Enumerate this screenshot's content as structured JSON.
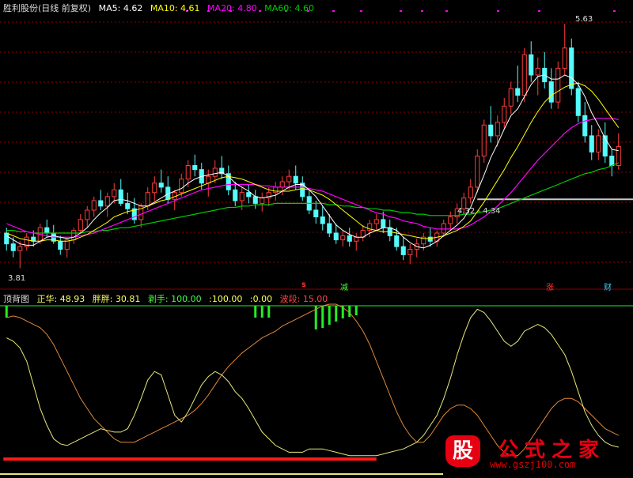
{
  "colors": {
    "bg": "#000000",
    "up": "#ff3c3c",
    "down": "#54fcfc",
    "ma5": "#ffffff",
    "ma10": "#ffff00",
    "ma20": "#ff00ff",
    "ma60": "#00cc00",
    "grid": "#8b0000",
    "line_a": "#e8e87a",
    "line_b": "#e0883a",
    "red_band": "#ff1a1a",
    "green_bar": "#22ee22",
    "support": "#c8c8c8"
  },
  "header": {
    "title": "胜利股份(日线 前复权)",
    "ma5_label": "MA5:",
    "ma5_value": "4.62",
    "ma10_label": "MA10:",
    "ma10_value": "4.61",
    "ma20_label": "MA20:",
    "ma20_value": "4.80",
    "ma60_label": "MA60:",
    "ma60_value": "4.60"
  },
  "indicator_header": {
    "name": "顶背图",
    "zhenghua_label": "正华:",
    "zhenghua_value": "48.93",
    "pangpang_label": "胖胖:",
    "pangpang_value": "30.81",
    "baoshou_label": "剥手:",
    "baoshou_value": "100.00",
    "v1_label": ":",
    "v1_value": "100.00",
    "v2_label": ":",
    "v2_value": "0.00",
    "boduan_label": "波段:",
    "boduan_value": "15.00"
  },
  "annotations": {
    "high_label": "5.63",
    "low_label": "3.81",
    "range_label": "4.32 - 4.34",
    "signal_s": "s",
    "signal_jian": "减",
    "signal_zhang": "涨",
    "signal_cai": "财"
  },
  "logo": {
    "mark": "股",
    "title": "公式之家",
    "url": "www.gszj100.com"
  },
  "chart_data": {
    "type": "candlestick",
    "price_range": [
      3.7,
      5.7
    ],
    "indicator_range": [
      0,
      100
    ],
    "high": 5.63,
    "low": 3.81,
    "candles": [
      [
        4.08,
        4.12,
        3.95,
        4.0
      ],
      [
        4.0,
        4.05,
        3.9,
        3.95
      ],
      [
        3.95,
        4.02,
        3.82,
        3.98
      ],
      [
        3.98,
        4.08,
        3.95,
        4.05
      ],
      [
        4.05,
        4.1,
        3.98,
        4.02
      ],
      [
        4.02,
        4.15,
        4.0,
        4.12
      ],
      [
        4.12,
        4.18,
        4.05,
        4.08
      ],
      [
        4.08,
        4.14,
        4.0,
        4.02
      ],
      [
        4.02,
        4.06,
        3.92,
        3.96
      ],
      [
        3.96,
        4.05,
        3.9,
        4.03
      ],
      [
        4.03,
        4.12,
        4.0,
        4.1
      ],
      [
        4.1,
        4.22,
        4.08,
        4.18
      ],
      [
        4.18,
        4.28,
        4.12,
        4.25
      ],
      [
        4.25,
        4.35,
        4.2,
        4.32
      ],
      [
        4.32,
        4.4,
        4.25,
        4.28
      ],
      [
        4.28,
        4.38,
        4.2,
        4.35
      ],
      [
        4.35,
        4.45,
        4.3,
        4.4
      ],
      [
        4.4,
        4.48,
        4.28,
        4.3
      ],
      [
        4.3,
        4.38,
        4.22,
        4.26
      ],
      [
        4.26,
        4.34,
        4.15,
        4.18
      ],
      [
        4.18,
        4.3,
        4.12,
        4.28
      ],
      [
        4.28,
        4.42,
        4.25,
        4.38
      ],
      [
        4.38,
        4.5,
        4.32,
        4.45
      ],
      [
        4.45,
        4.55,
        4.38,
        4.42
      ],
      [
        4.42,
        4.5,
        4.3,
        4.33
      ],
      [
        4.33,
        4.4,
        4.25,
        4.38
      ],
      [
        4.38,
        4.52,
        4.35,
        4.48
      ],
      [
        4.48,
        4.62,
        4.42,
        4.58
      ],
      [
        4.58,
        4.66,
        4.5,
        4.55
      ],
      [
        4.55,
        4.6,
        4.4,
        4.45
      ],
      [
        4.45,
        4.55,
        4.35,
        4.5
      ],
      [
        4.5,
        4.62,
        4.45,
        4.56
      ],
      [
        4.56,
        4.65,
        4.48,
        4.52
      ],
      [
        4.52,
        4.58,
        4.36,
        4.4
      ],
      [
        4.4,
        4.46,
        4.28,
        4.32
      ],
      [
        4.32,
        4.42,
        4.25,
        4.38
      ],
      [
        4.38,
        4.44,
        4.3,
        4.35
      ],
      [
        4.35,
        4.4,
        4.26,
        4.3
      ],
      [
        4.3,
        4.38,
        4.24,
        4.34
      ],
      [
        4.34,
        4.42,
        4.28,
        4.38
      ],
      [
        4.38,
        4.46,
        4.32,
        4.42
      ],
      [
        4.42,
        4.5,
        4.36,
        4.46
      ],
      [
        4.46,
        4.55,
        4.4,
        4.5
      ],
      [
        4.5,
        4.58,
        4.4,
        4.45
      ],
      [
        4.45,
        4.5,
        4.32,
        4.35
      ],
      [
        4.35,
        4.4,
        4.22,
        4.25
      ],
      [
        4.25,
        4.32,
        4.15,
        4.2
      ],
      [
        4.2,
        4.28,
        4.1,
        4.15
      ],
      [
        4.15,
        4.22,
        4.05,
        4.08
      ],
      [
        4.08,
        4.15,
        4.0,
        4.03
      ],
      [
        4.03,
        4.1,
        3.98,
        4.06
      ],
      [
        4.06,
        4.12,
        3.98,
        4.02
      ],
      [
        4.02,
        4.08,
        3.95,
        4.05
      ],
      [
        4.05,
        4.14,
        4.02,
        4.1
      ],
      [
        4.1,
        4.18,
        4.05,
        4.15
      ],
      [
        4.15,
        4.22,
        4.1,
        4.18
      ],
      [
        4.18,
        4.24,
        4.08,
        4.12
      ],
      [
        4.12,
        4.18,
        4.02,
        4.06
      ],
      [
        4.06,
        4.12,
        3.95,
        3.98
      ],
      [
        3.98,
        4.05,
        3.88,
        3.92
      ],
      [
        3.92,
        4.0,
        3.85,
        3.96
      ],
      [
        3.96,
        4.04,
        3.9,
        4.0
      ],
      [
        4.0,
        4.08,
        3.95,
        4.05
      ],
      [
        4.05,
        4.12,
        3.98,
        4.02
      ],
      [
        4.02,
        4.1,
        3.98,
        4.08
      ],
      [
        4.08,
        4.18,
        4.05,
        4.15
      ],
      [
        4.15,
        4.24,
        4.1,
        4.2
      ],
      [
        4.2,
        4.3,
        4.15,
        4.26
      ],
      [
        4.26,
        4.38,
        4.22,
        4.34
      ],
      [
        4.34,
        4.48,
        4.3,
        4.42
      ],
      [
        4.42,
        4.7,
        4.38,
        4.65
      ],
      [
        4.65,
        4.92,
        4.6,
        4.88
      ],
      [
        4.88,
        5.02,
        4.75,
        4.8
      ],
      [
        4.8,
        4.95,
        4.72,
        4.9
      ],
      [
        4.9,
        5.08,
        4.85,
        5.02
      ],
      [
        5.02,
        5.2,
        4.96,
        5.15
      ],
      [
        5.15,
        5.32,
        5.05,
        5.1
      ],
      [
        5.1,
        5.45,
        5.05,
        5.4
      ],
      [
        5.4,
        5.5,
        5.2,
        5.25
      ],
      [
        5.25,
        5.38,
        5.1,
        5.3
      ],
      [
        5.3,
        5.42,
        5.15,
        5.2
      ],
      [
        5.2,
        5.3,
        5.0,
        5.05
      ],
      [
        5.05,
        5.35,
        5.0,
        5.3
      ],
      [
        5.3,
        5.63,
        5.25,
        5.45
      ],
      [
        5.45,
        5.52,
        5.1,
        5.15
      ],
      [
        5.15,
        5.2,
        4.9,
        4.95
      ],
      [
        4.95,
        5.05,
        4.75,
        4.8
      ],
      [
        4.8,
        4.88,
        4.62,
        4.68
      ],
      [
        4.68,
        4.85,
        4.62,
        4.8
      ],
      [
        4.8,
        4.9,
        4.6,
        4.65
      ],
      [
        4.65,
        4.7,
        4.5,
        4.58
      ],
      [
        4.58,
        4.82,
        4.55,
        4.72
      ]
    ],
    "ma5": [
      4.06,
      4.03,
      4.0,
      3.99,
      3.99,
      4.02,
      4.05,
      4.06,
      4.05,
      4.04,
      4.05,
      4.08,
      4.12,
      4.18,
      4.23,
      4.27,
      4.32,
      4.33,
      4.32,
      4.3,
      4.28,
      4.28,
      4.31,
      4.34,
      4.37,
      4.39,
      4.41,
      4.45,
      4.48,
      4.5,
      4.51,
      4.52,
      4.53,
      4.5,
      4.45,
      4.42,
      4.39,
      4.35,
      4.34,
      4.35,
      4.36,
      4.39,
      4.42,
      4.44,
      4.44,
      4.4,
      4.35,
      4.28,
      4.21,
      4.14,
      4.1,
      4.07,
      4.05,
      4.05,
      4.08,
      4.1,
      4.12,
      4.12,
      4.1,
      4.05,
      4.01,
      3.98,
      3.97,
      3.99,
      4.02,
      4.06,
      4.1,
      4.14,
      4.19,
      4.27,
      4.39,
      4.51,
      4.64,
      4.74,
      4.85,
      4.95,
      5.0,
      5.09,
      5.18,
      5.24,
      5.25,
      5.22,
      5.22,
      5.25,
      5.23,
      5.18,
      5.09,
      4.97,
      4.88,
      4.78,
      4.7,
      4.69
    ],
    "ma10": [
      4.08,
      4.06,
      4.04,
      4.03,
      4.02,
      4.02,
      4.03,
      4.03,
      4.02,
      4.02,
      4.03,
      4.05,
      4.07,
      4.1,
      4.13,
      4.16,
      4.2,
      4.22,
      4.24,
      4.25,
      4.26,
      4.28,
      4.3,
      4.32,
      4.33,
      4.35,
      4.37,
      4.39,
      4.41,
      4.43,
      4.45,
      4.47,
      4.49,
      4.5,
      4.49,
      4.48,
      4.46,
      4.44,
      4.42,
      4.4,
      4.39,
      4.39,
      4.39,
      4.4,
      4.41,
      4.4,
      4.38,
      4.36,
      4.33,
      4.29,
      4.25,
      4.21,
      4.17,
      4.13,
      4.11,
      4.1,
      4.09,
      4.09,
      4.08,
      4.07,
      4.06,
      4.05,
      4.04,
      4.04,
      4.05,
      4.06,
      4.08,
      4.1,
      4.13,
      4.17,
      4.24,
      4.31,
      4.39,
      4.47,
      4.55,
      4.64,
      4.72,
      4.81,
      4.9,
      4.98,
      5.05,
      5.1,
      5.13,
      5.16,
      5.18,
      5.19,
      5.17,
      5.13,
      5.07,
      5.0,
      4.93,
      4.86
    ],
    "ma20": [
      4.15,
      4.13,
      4.11,
      4.09,
      4.08,
      4.07,
      4.06,
      4.05,
      4.05,
      4.05,
      4.05,
      4.06,
      4.07,
      4.08,
      4.1,
      4.12,
      4.14,
      4.16,
      4.18,
      4.2,
      4.22,
      4.24,
      4.26,
      4.28,
      4.3,
      4.32,
      4.34,
      4.36,
      4.38,
      4.4,
      4.41,
      4.42,
      4.43,
      4.44,
      4.44,
      4.44,
      4.44,
      4.44,
      4.43,
      4.43,
      4.42,
      4.42,
      4.42,
      4.42,
      4.42,
      4.41,
      4.4,
      4.39,
      4.37,
      4.35,
      4.33,
      4.31,
      4.29,
      4.27,
      4.25,
      4.23,
      4.22,
      4.2,
      4.19,
      4.17,
      4.16,
      4.15,
      4.13,
      4.12,
      4.11,
      4.11,
      4.11,
      4.11,
      4.12,
      4.14,
      4.17,
      4.2,
      4.24,
      4.28,
      4.33,
      4.38,
      4.44,
      4.5,
      4.56,
      4.62,
      4.67,
      4.72,
      4.77,
      4.82,
      4.86,
      4.89,
      4.91,
      4.92,
      4.93,
      4.93,
      4.93,
      4.92
    ],
    "ma60": [
      4.1,
      4.1,
      4.09,
      4.09,
      4.08,
      4.08,
      4.08,
      4.08,
      4.08,
      4.08,
      4.08,
      4.08,
      4.09,
      4.09,
      4.1,
      4.1,
      4.11,
      4.12,
      4.12,
      4.13,
      4.14,
      4.15,
      4.16,
      4.17,
      4.18,
      4.19,
      4.2,
      4.21,
      4.22,
      4.23,
      4.24,
      4.25,
      4.26,
      4.27,
      4.27,
      4.28,
      4.28,
      4.29,
      4.29,
      4.29,
      4.3,
      4.3,
      4.3,
      4.3,
      4.3,
      4.3,
      4.3,
      4.3,
      4.29,
      4.29,
      4.28,
      4.28,
      4.27,
      4.27,
      4.26,
      4.26,
      4.25,
      4.25,
      4.24,
      4.23,
      4.23,
      4.22,
      4.22,
      4.21,
      4.21,
      4.21,
      4.21,
      4.21,
      4.22,
      4.22,
      4.23,
      4.24,
      4.25,
      4.26,
      4.28,
      4.3,
      4.32,
      4.34,
      4.36,
      4.38,
      4.4,
      4.42,
      4.44,
      4.46,
      4.48,
      4.5,
      4.52,
      4.53,
      4.55,
      4.56,
      4.58,
      4.6
    ],
    "line_a": [
      80,
      78,
      74,
      66,
      52,
      38,
      28,
      20,
      17,
      16,
      18,
      20,
      22,
      24,
      26,
      25,
      24,
      24,
      26,
      34,
      44,
      55,
      60,
      58,
      46,
      34,
      30,
      36,
      44,
      52,
      57,
      60,
      58,
      54,
      48,
      44,
      38,
      31,
      24,
      20,
      16,
      14,
      12,
      12,
      12,
      14,
      14,
      14,
      13,
      12,
      11,
      10,
      10,
      10,
      10,
      10,
      11,
      12,
      13,
      14,
      16,
      18,
      22,
      28,
      34,
      44,
      56,
      70,
      82,
      92,
      97,
      95,
      90,
      84,
      78,
      75,
      78,
      84,
      86,
      88,
      86,
      82,
      76,
      70,
      60,
      48,
      36,
      28,
      22,
      18,
      16,
      15
    ],
    "line_b": [
      92,
      93,
      92,
      90,
      88,
      86,
      82,
      76,
      68,
      60,
      52,
      44,
      38,
      32,
      28,
      24,
      20,
      18,
      18,
      18,
      20,
      22,
      24,
      26,
      28,
      30,
      32,
      34,
      37,
      41,
      46,
      52,
      58,
      63,
      67,
      71,
      74,
      77,
      80,
      82,
      84,
      87,
      89,
      91,
      93,
      95,
      97,
      99,
      100,
      100,
      98,
      95,
      90,
      84,
      76,
      66,
      56,
      46,
      36,
      28,
      22,
      18,
      18,
      22,
      28,
      34,
      38,
      40,
      40,
      38,
      34,
      28,
      22,
      16,
      12,
      10,
      10,
      14,
      20,
      26,
      32,
      38,
      42,
      44,
      44,
      42,
      38,
      34,
      30,
      26,
      24,
      22
    ],
    "green_bars": [
      {
        "index": 0,
        "height": 15
      },
      {
        "index": 37,
        "height": 15
      },
      {
        "index": 38,
        "height": 15
      },
      {
        "index": 39,
        "height": 15
      },
      {
        "index": 46,
        "height": 30
      },
      {
        "index": 47,
        "height": 28
      },
      {
        "index": 48,
        "height": 24
      },
      {
        "index": 49,
        "height": 20
      },
      {
        "index": 50,
        "height": 16
      },
      {
        "index": 51,
        "height": 14
      },
      {
        "index": 52,
        "height": 12
      }
    ],
    "red_band": {
      "from": 0,
      "to": 55,
      "value": 8
    },
    "support_line": 4.33
  }
}
